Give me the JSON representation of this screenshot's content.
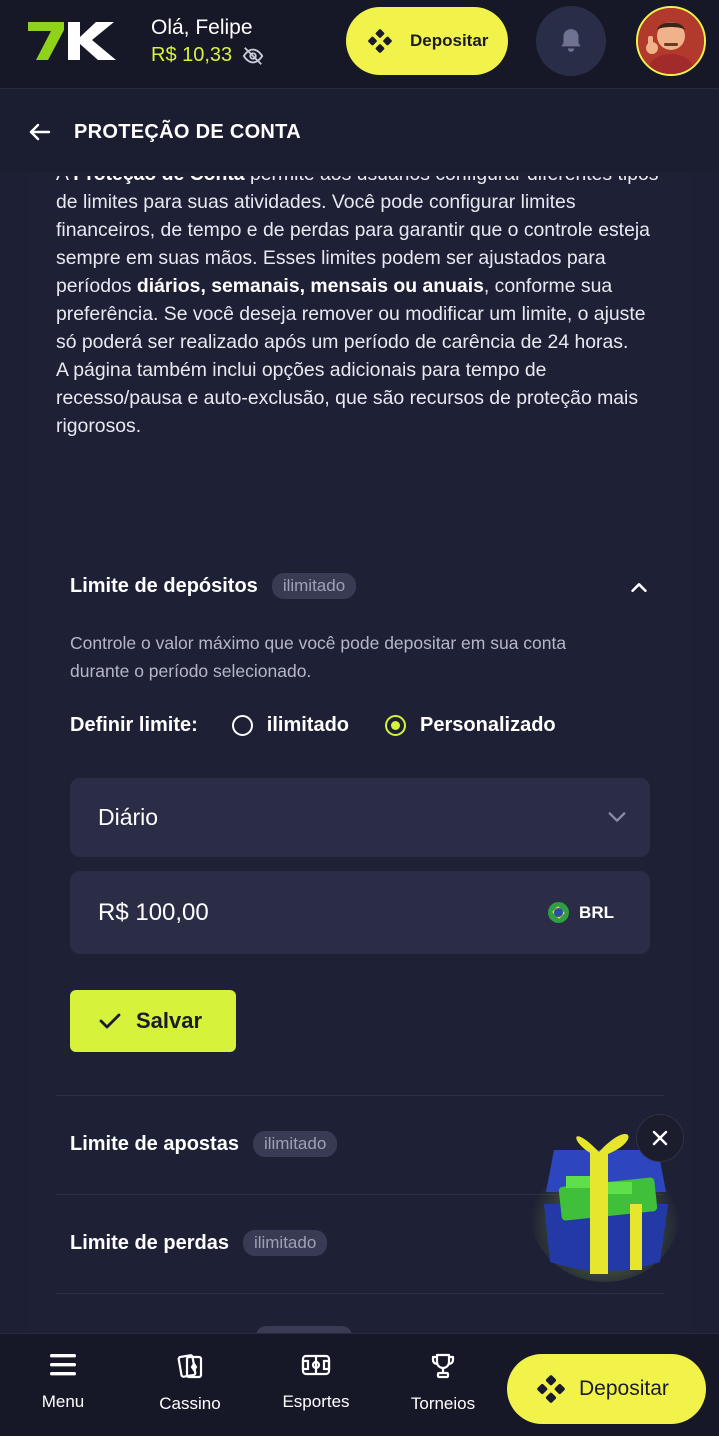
{
  "header": {
    "logo_text": "7K",
    "greeting": "Olá, Felipe",
    "balance": "R$ 10,33",
    "deposit_label": "Depositar"
  },
  "page": {
    "title": "PROTEÇÃO DE CONTA"
  },
  "intro": {
    "line1_prefix": "A ",
    "line1_bold": "Proteção de Conta",
    "line1_rest": " permite aos usuários configurar diferentes tipos de limites para suas atividades. Você pode configurar limites financeiros, de tempo e de perdas para garantir que o controle esteja sempre em suas mãos. Esses limites podem ser ajustados para períodos ",
    "periods_bold": "diários, semanais, mensais ou anuais",
    "line1_end": ", conforme sua preferência. Se você deseja remover ou modificar um limite, o ajuste só poderá ser realizado após um período de carência de 24 horas.",
    "paragraph2": "A página também inclui opções adicionais para tempo de recesso/pausa e auto-exclusão, que são recursos de proteção mais rigorosos."
  },
  "deposit_limit": {
    "title": "Limite de depósitos",
    "badge": "ilimitado",
    "description": "Controle o valor máximo que você pode depositar em sua conta durante o período selecionado.",
    "define_label": "Definir limite:",
    "option_unlimited": "ilimitado",
    "option_custom": "Personalizado",
    "selected_option": "Personalizado",
    "period_value": "Diário",
    "amount_value": "R$ 100,00",
    "currency": "BRL",
    "save_label": "Salvar"
  },
  "bet_limit": {
    "title": "Limite de apostas",
    "badge": "ilimitado"
  },
  "loss_limit": {
    "title": "Limite de perdas",
    "badge": "ilimitado"
  },
  "bottom_nav": {
    "items": [
      {
        "label": "Menu",
        "icon": "menu-icon"
      },
      {
        "label": "Cassino",
        "icon": "cards-icon"
      },
      {
        "label": "Esportes",
        "icon": "soccer-field-icon"
      },
      {
        "label": "Torneios",
        "icon": "trophy-icon"
      }
    ],
    "deposit_label": "Depositar"
  },
  "colors": {
    "accent_yellow": "#f2f34a",
    "accent_lime": "#d6f23a",
    "background": "#1d2035",
    "header_bg": "#161828"
  }
}
